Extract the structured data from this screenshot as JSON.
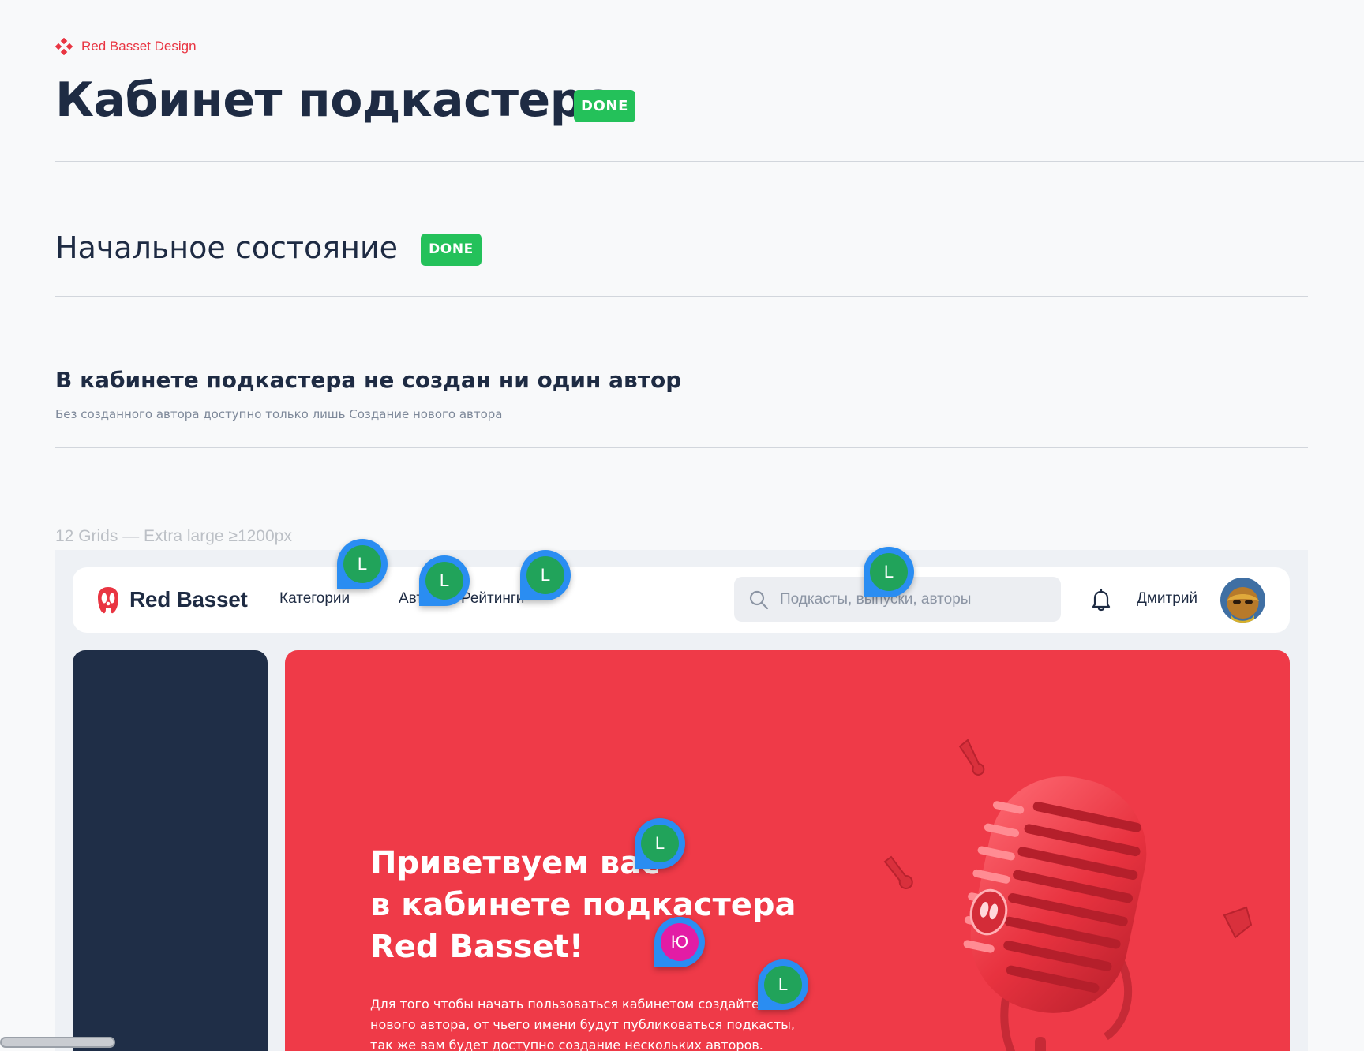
{
  "brand": {
    "name": "Red Basset Design",
    "accent": "#e93542"
  },
  "page": {
    "title": "Кабинет подкастера",
    "status": "DONE"
  },
  "section": {
    "title": "Начальное состояние",
    "status": "DONE"
  },
  "state": {
    "title": "В кабинете подкастера не создан ни один автор",
    "description": "Без созданного автора доступно только лишь Создание нового автора"
  },
  "grid_label": "12 Grids — Extra large ≥1200px",
  "app": {
    "logo_text": "Red Basset",
    "nav": [
      "Категории",
      "Авторы",
      "Рейтинги"
    ],
    "search_placeholder": "Подкасты, выпуски, авторы",
    "user_name": "Дмитрий",
    "icons": {
      "search": "search-icon",
      "notifications": "bell-icon",
      "logo": "basset-logo-icon"
    }
  },
  "hero": {
    "title_lines": [
      "Приветвуем вас",
      "в кабинете подкастера",
      "Red Basset!"
    ],
    "text_lines": [
      "Для того чтобы начать пользоваться кабинетом создайте",
      "нового автора, от чьего имени будут публиковаться подкасты,",
      "так же вам будет доступно создание нескольких авторов."
    ],
    "background": "#ef3a48"
  },
  "comment_pins": [
    "L",
    "L",
    "L",
    "L",
    "L",
    "Ю",
    "L"
  ],
  "colors": {
    "done_badge": "#24c15a",
    "sidebar": "#1f2e47",
    "pin_ring": "#2a8df2"
  }
}
